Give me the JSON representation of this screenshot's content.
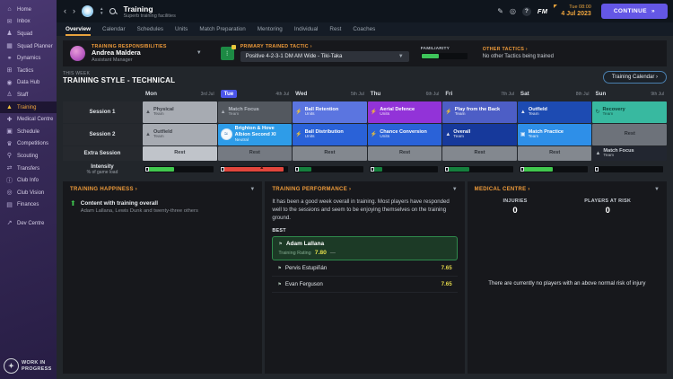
{
  "accent": {
    "orange": "#ef9b3a",
    "purple_button": "#6457e6",
    "today_pill": "#4b55e8"
  },
  "sidebar": {
    "items": [
      {
        "label": "Home",
        "icon": "home"
      },
      {
        "label": "Inbox",
        "icon": "inbox"
      },
      {
        "label": "Squad",
        "icon": "shirt"
      },
      {
        "label": "Squad Planner",
        "icon": "clipboard"
      },
      {
        "label": "Dynamics",
        "icon": "people"
      },
      {
        "label": "Tactics",
        "icon": "pitch"
      },
      {
        "label": "Data Hub",
        "icon": "data"
      },
      {
        "label": "Staff",
        "icon": "staff"
      },
      {
        "label": "Training",
        "icon": "cone",
        "active": true
      },
      {
        "label": "Medical Centre",
        "icon": "medical"
      },
      {
        "label": "Schedule",
        "icon": "calendar"
      },
      {
        "label": "Competitions",
        "icon": "trophy"
      },
      {
        "label": "Scouting",
        "icon": "scout"
      },
      {
        "label": "Transfers",
        "icon": "transfers"
      },
      {
        "label": "Club Info",
        "icon": "info"
      },
      {
        "label": "Club Vision",
        "icon": "vision"
      },
      {
        "label": "Finances",
        "icon": "finances"
      },
      {
        "label": "Dev Centre",
        "icon": "dev",
        "gap": true
      }
    ],
    "footer_line1": "WORK IN",
    "footer_line2": "PROGRESS"
  },
  "header": {
    "title": "Training",
    "subtitle": "Superb training facilities",
    "fm_logo": "FM",
    "time": "Tue 08:00",
    "date": "4 Jul 2023",
    "continue_label": "CONTINUE",
    "continue_arrow": "»"
  },
  "tabs": {
    "active": "Overview",
    "items": [
      "Overview",
      "Calendar",
      "Schedules",
      "Units",
      "Match Preparation",
      "Mentoring",
      "Individual",
      "Rest",
      "Coaches"
    ]
  },
  "responsibilities": {
    "heading": "TRAINING RESPONSIBILITIES",
    "name": "Andrea Maldera",
    "role": "Assistant Manager"
  },
  "primary_tactic": {
    "heading": "PRIMARY TRAINED TACTIC ›",
    "value": "Positive 4-2-3-1 DM AM Wide - Tiki-Taka",
    "familiarity_label": "FAMILIARITY",
    "familiarity_pct": 38
  },
  "other_tactics": {
    "heading": "OTHER TACTICS ›",
    "text": "No other Tactics being trained"
  },
  "week": {
    "eyebrow": "THIS WEEK",
    "title": "TRAINING STYLE - TECHNICAL",
    "calendar_button": "Training Calendar ›",
    "row_labels": {
      "session1": "Session 1",
      "session2": "Session 2",
      "extra": "Extra Session",
      "intensity": "Intensity",
      "intensity_sub": "% of game load"
    },
    "days": [
      {
        "name": "Mon",
        "date": "3rd Jul",
        "today": false,
        "s1": {
          "label": "Physical",
          "sub": "Team",
          "icon": "cone",
          "bg": "#a7abb2",
          "fg": "#3a3e45"
        },
        "s2": {
          "label": "Outfield",
          "sub": "Team",
          "icon": "cone",
          "bg": "#a7abb2",
          "fg": "#3a3e45"
        },
        "extra": {
          "label": "Rest",
          "bg": "#c0c4ca",
          "fg": "#34383f"
        },
        "intensity": {
          "pct": 45,
          "color": "#41c84e",
          "warn": false
        }
      },
      {
        "name": "Tue",
        "date": "4th Jul",
        "today": true,
        "s1": {
          "label": "Match Focus",
          "sub": "Team",
          "icon": "cone",
          "bg": "#53585f",
          "fg": "#b9bec6"
        },
        "s2": {
          "label": "Brighton & Hove Albion Second XI",
          "sub": "Neutral",
          "badge": true,
          "bg": "#2e9ce8",
          "fg": "#ffffff"
        },
        "extra": {
          "label": "Rest",
          "bg": "#757a82",
          "fg": "#2e3238"
        },
        "intensity": {
          "pct": 95,
          "color": "#e2463c",
          "warn": true
        }
      },
      {
        "name": "Wed",
        "date": "5th Jul",
        "today": false,
        "s1": {
          "label": "Ball Retention",
          "sub": "Units",
          "icon": "bolt",
          "bg": "#5b75e0",
          "fg": "#ffffff"
        },
        "s2": {
          "label": "Ball Distribution",
          "sub": "Units",
          "icon": "bolt",
          "bg": "#2a62d8",
          "fg": "#ffffff"
        },
        "extra": {
          "label": "Rest",
          "bg": "#83888f",
          "fg": "#2b2f35"
        },
        "intensity": {
          "pct": 26,
          "color": "#15803d",
          "warn": false
        }
      },
      {
        "name": "Thu",
        "date": "6th Jul",
        "today": false,
        "s1": {
          "label": "Aerial Defence",
          "sub": "Units",
          "icon": "bolt",
          "bg": "#9233d8",
          "fg": "#ffffff"
        },
        "s2": {
          "label": "Chance Conversion",
          "sub": "Units",
          "icon": "bolt",
          "bg": "#2a62d8",
          "fg": "#ffffff"
        },
        "extra": {
          "label": "Rest",
          "bg": "#83888f",
          "fg": "#2b2f35"
        },
        "intensity": {
          "pct": 20,
          "color": "#15803d",
          "warn": false
        }
      },
      {
        "name": "Fri",
        "date": "7th Jul",
        "today": false,
        "s1": {
          "label": "Play from the Back",
          "sub": "Team",
          "icon": "bolt",
          "bg": "#4d5ec6",
          "fg": "#ffffff"
        },
        "s2": {
          "label": "Overall",
          "sub": "Team",
          "icon": "cone",
          "bg": "#16399b",
          "fg": "#ffffff"
        },
        "extra": {
          "label": "Rest",
          "bg": "#83888f",
          "fg": "#2b2f35"
        },
        "intensity": {
          "pct": 38,
          "color": "#15803d",
          "warn": false
        }
      },
      {
        "name": "Sat",
        "date": "8th Jul",
        "today": false,
        "s1": {
          "label": "Outfield",
          "sub": "Team",
          "icon": "cone",
          "bg": "#1d4bb2",
          "fg": "#ffffff"
        },
        "s2": {
          "label": "Match Practice",
          "sub": "Team",
          "icon": "board",
          "bg": "#2e8fe8",
          "fg": "#ffffff"
        },
        "extra": {
          "label": "Rest",
          "bg": "#83888f",
          "fg": "#2b2f35"
        },
        "intensity": {
          "pct": 50,
          "color": "#41c84e",
          "warn": false
        }
      },
      {
        "name": "Sun",
        "date": "9th Jul",
        "today": false,
        "s1": {
          "label": "Recovery",
          "sub": "Team",
          "icon": "recovery",
          "bg": "#38b9a0",
          "fg": "#0e4237"
        },
        "s2": {
          "label": "Rest",
          "sub": "",
          "bg": "#6d727a",
          "fg": "#2b2f35"
        },
        "extra": {
          "label": "Match Focus",
          "sub": "Team",
          "icon": "cone",
          "bg": "#222630",
          "fg": "#cfd4da"
        },
        "intensity": {
          "pct": 4,
          "color": "#3a5fd9",
          "warn": false
        }
      }
    ]
  },
  "panels": {
    "happiness": {
      "heading": "TRAINING HAPPINESS ›",
      "item_title": "Content with training overall",
      "item_sub": "Adam Lallana, Lewis Dunk and twenty-three others"
    },
    "performance": {
      "heading": "TRAINING PERFORMANCE ›",
      "summary": "It has been a good week overall in training. Most players have responded well to the sessions and seem to be enjoying themselves on the training ground.",
      "best_label": "BEST",
      "best": {
        "name": "Adam Lallana",
        "rating_label": "Training Rating",
        "rating": "7.80",
        "trend": "—"
      },
      "others": [
        {
          "name": "Pervis Estupiñán",
          "rating": "7.65"
        },
        {
          "name": "Evan Ferguson",
          "rating": "7.65"
        }
      ]
    },
    "medical": {
      "heading": "MEDICAL CENTRE ›",
      "stats": [
        {
          "label": "INJURIES",
          "value": "0"
        },
        {
          "label": "PLAYERS AT RISK",
          "value": "0"
        }
      ],
      "note": "There are currently no players with an above normal risk of injury"
    }
  }
}
